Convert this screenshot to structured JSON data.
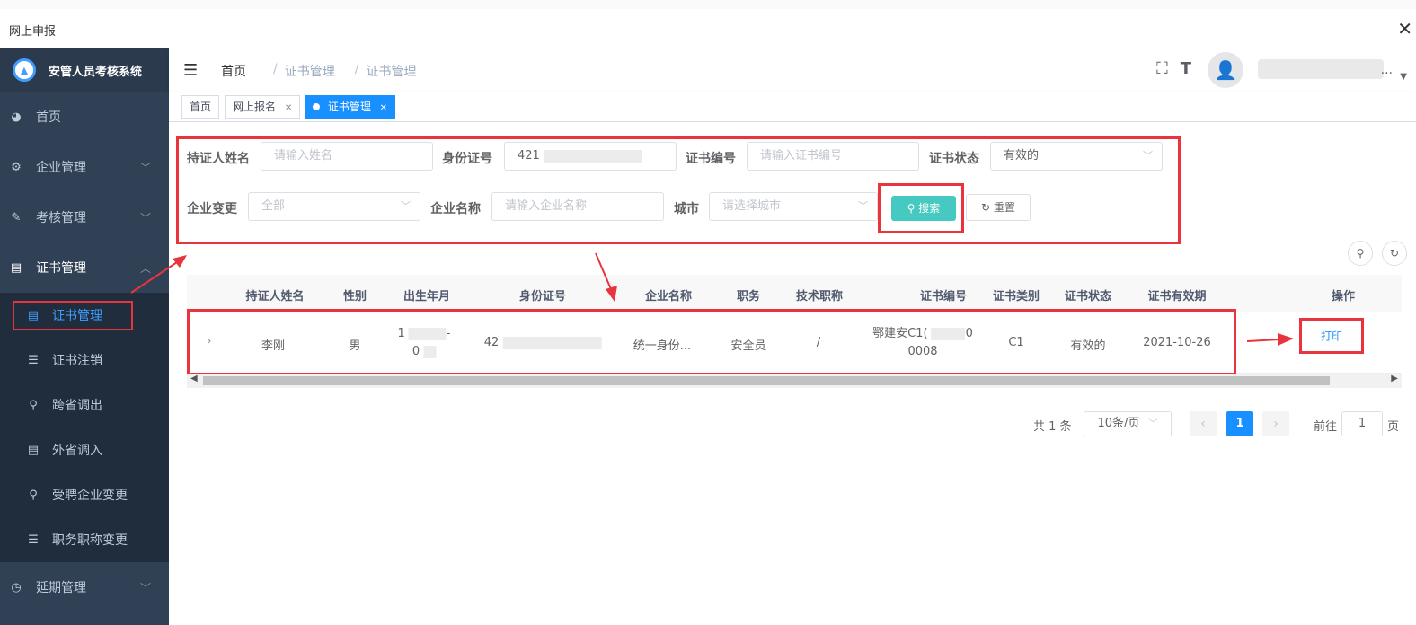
{
  "window": {
    "title": "网上申报",
    "close_glyph": "✕"
  },
  "sidebar": {
    "brand": "安管人员考核系统",
    "items": [
      {
        "label": "首页",
        "icon": "dashboard-icon"
      },
      {
        "label": "企业管理",
        "icon": "gear-icon"
      },
      {
        "label": "考核管理",
        "icon": "edit-icon"
      },
      {
        "label": "证书管理",
        "icon": "certificate-icon"
      }
    ],
    "sub_items": [
      {
        "label": "证书管理",
        "icon": "certificate-icon"
      },
      {
        "label": "证书注销",
        "icon": "list-icon"
      },
      {
        "label": "跨省调出",
        "icon": "search-icon"
      },
      {
        "label": "外省调入",
        "icon": "certificate-icon"
      },
      {
        "label": "受聘企业变更",
        "icon": "search-icon"
      },
      {
        "label": "职务职称变更",
        "icon": "list-icon"
      }
    ],
    "bottom_item": {
      "label": "延期管理",
      "icon": "clock-icon"
    }
  },
  "header": {
    "breadcrumb": [
      "首页",
      "证书管理",
      "证书管理"
    ],
    "user_suffix": "..."
  },
  "tags": [
    {
      "label": "首页"
    },
    {
      "label": "网上报名"
    },
    {
      "label": "证书管理"
    }
  ],
  "search": {
    "holder_name_label": "持证人姓名",
    "holder_name_placeholder": "请输入姓名",
    "id_label": "身份证号",
    "id_value": "421",
    "cert_no_label": "证书编号",
    "cert_no_placeholder": "请输入证书编号",
    "cert_status_label": "证书状态",
    "cert_status_value": "有效的",
    "company_change_label": "企业变更",
    "company_change_value": "全部",
    "company_name_label": "企业名称",
    "company_name_placeholder": "请输入企业名称",
    "city_label": "城市",
    "city_placeholder": "请选择城市",
    "search_button": "搜索",
    "reset_button": "重置"
  },
  "table": {
    "columns": [
      "持证人姓名",
      "性别",
      "出生年月",
      "身份证号",
      "企业名称",
      "职务",
      "技术职称",
      "证书编号",
      "证书类别",
      "证书状态",
      "证书有效期",
      "操作"
    ],
    "rows": [
      {
        "name": "李刚",
        "gender": "男",
        "birth_line1": "1",
        "birth_line2": "0",
        "id_no": "42",
        "company": "统一身份...",
        "position": "安全员",
        "title": "/",
        "cert_no_line1": "鄂建安C1(",
        "cert_no_line2": "0008",
        "cert_type": "C1",
        "status": "有效的",
        "valid_until": "2021-10-26",
        "action": "打印"
      }
    ]
  },
  "pagination": {
    "total": "共 1 条",
    "page_size": "10条/页",
    "current": "1",
    "goto_label": "前往",
    "goto_value": "1",
    "page_suffix": "页"
  },
  "colors": {
    "accent": "#1890ff",
    "search_button": "#46c9c0",
    "highlight": "#e8343d",
    "sidebar_bg": "#304156"
  }
}
